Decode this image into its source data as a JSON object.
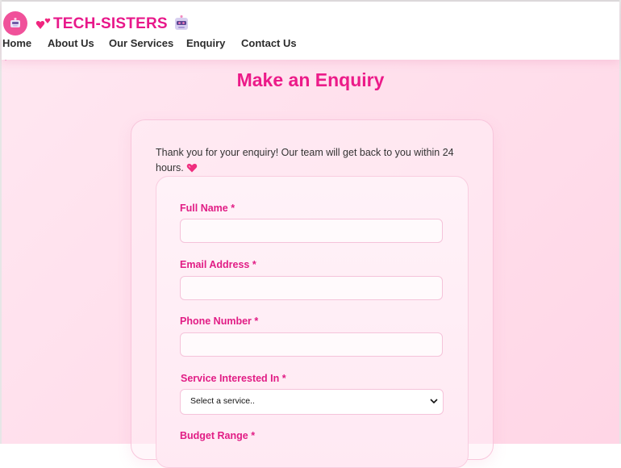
{
  "header": {
    "brand": "TECH-SISTERS",
    "nav": [
      "Home",
      "About Us",
      "Our Services",
      "Enquiry",
      "Contact Us"
    ]
  },
  "main": {
    "title": "Make an Enquiry",
    "thanks_message": "Thank you for your enquiry! Our team will get back to you within 24 hours.",
    "form": {
      "full_name_label": "Full Name *",
      "email_label": "Email Address *",
      "phone_label": "Phone Number *",
      "service_label": "Service Interested In *",
      "service_selected": "Select a service..",
      "budget_label": "Budget Range *",
      "full_name_value": "",
      "email_value": "",
      "phone_value": ""
    }
  },
  "colors": {
    "accent": "#e8188a",
    "logo_circle": "#f0519a",
    "background_start": "#ffe7f1",
    "background_end": "#ffd6e6"
  },
  "icons": {
    "logo": "robot-face-icon",
    "brand_left": "two-hearts-icon",
    "brand_right": "robot-icon",
    "thanks": "heart-icon"
  }
}
